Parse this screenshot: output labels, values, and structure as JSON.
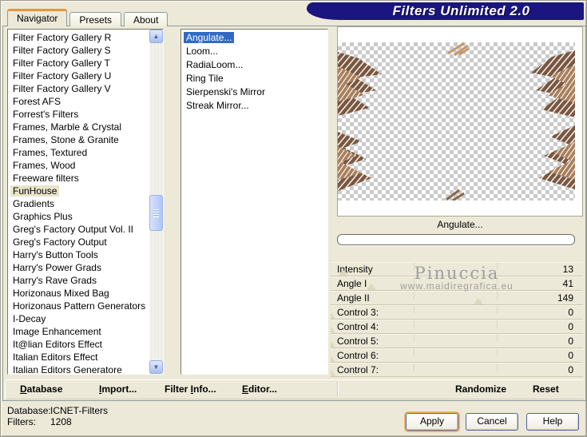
{
  "window": {
    "title": "Filters Unlimited 2.0"
  },
  "tabs": [
    {
      "label": "Navigator",
      "active": true
    },
    {
      "label": "Presets"
    },
    {
      "label": "About"
    }
  ],
  "category_list": {
    "items": [
      {
        "label": "Filter Factory Gallery R"
      },
      {
        "label": "Filter Factory Gallery S"
      },
      {
        "label": "Filter Factory Gallery T"
      },
      {
        "label": "Filter Factory Gallery U"
      },
      {
        "label": "Filter Factory Gallery V"
      },
      {
        "label": "Forest AFS"
      },
      {
        "label": "Forrest's Filters"
      },
      {
        "label": "Frames, Marble & Crystal"
      },
      {
        "label": "Frames, Stone & Granite"
      },
      {
        "label": "Frames, Textured"
      },
      {
        "label": "Frames, Wood"
      },
      {
        "label": "Freeware filters"
      },
      {
        "label": "FunHouse",
        "selected": true
      },
      {
        "label": "Gradients"
      },
      {
        "label": "Graphics Plus"
      },
      {
        "label": "Greg's Factory Output Vol. II"
      },
      {
        "label": "Greg's Factory Output"
      },
      {
        "label": "Harry's Button Tools"
      },
      {
        "label": "Harry's Power Grads"
      },
      {
        "label": "Harry's Rave Grads"
      },
      {
        "label": "Horizonaus Mixed Bag"
      },
      {
        "label": "Horizonaus Pattern Generators"
      },
      {
        "label": "I-Decay"
      },
      {
        "label": "Image Enhancement"
      },
      {
        "label": "It@lian Editors Effect"
      },
      {
        "label": "Italian Editors Effect"
      },
      {
        "label": "Italian Editors Generatore"
      }
    ]
  },
  "filter_list": {
    "items": [
      {
        "label": "Angulate...",
        "selected": true
      },
      {
        "label": "Loom..."
      },
      {
        "label": "RadiaLoom..."
      },
      {
        "label": "Ring Tile"
      },
      {
        "label": "Sierpenski's Mirror"
      },
      {
        "label": "Streak Mirror..."
      }
    ]
  },
  "preview": {
    "filter_name": "Angulate...",
    "progress_percent": 0
  },
  "parameters": [
    {
      "label": "Intensity",
      "value": 13
    },
    {
      "label": "Angle I",
      "value": 41
    },
    {
      "label": "Angle II",
      "value": 149
    },
    {
      "label": "Control 3:",
      "value": 0
    },
    {
      "label": "Control 4:",
      "value": 0
    },
    {
      "label": "Control 5:",
      "value": 0
    },
    {
      "label": "Control 6:",
      "value": 0
    },
    {
      "label": "Control 7:",
      "value": 0
    }
  ],
  "watermark": {
    "line1": "Pinuccia",
    "line2": "www.maidiregrafica.eu"
  },
  "toolbar": {
    "database": {
      "pre": "",
      "u": "D",
      "post": "atabase"
    },
    "import": {
      "pre": "",
      "u": "I",
      "post": "mport..."
    },
    "filter_info": {
      "pre": "Filter ",
      "u": "I",
      "post": "nfo..."
    },
    "editor": {
      "pre": "",
      "u": "E",
      "post": "ditor..."
    },
    "randomize": {
      "label": "Randomize"
    },
    "reset": {
      "label": "Reset"
    }
  },
  "status": {
    "database_label": "Database:",
    "database_value": "ICNET-Filters",
    "filters_label": "Filters:",
    "filters_value": "1208"
  },
  "actions": {
    "apply": "Apply",
    "cancel": "Cancel",
    "help": "Help"
  },
  "icons": {
    "scroll_up_icon": "▲",
    "scroll_down_icon": "▼"
  },
  "colors": {
    "title_bg": "#1a157f",
    "selection": "#316ac5",
    "category_highlight": "#e9e5c9",
    "tab_accent": "#e8953c"
  }
}
